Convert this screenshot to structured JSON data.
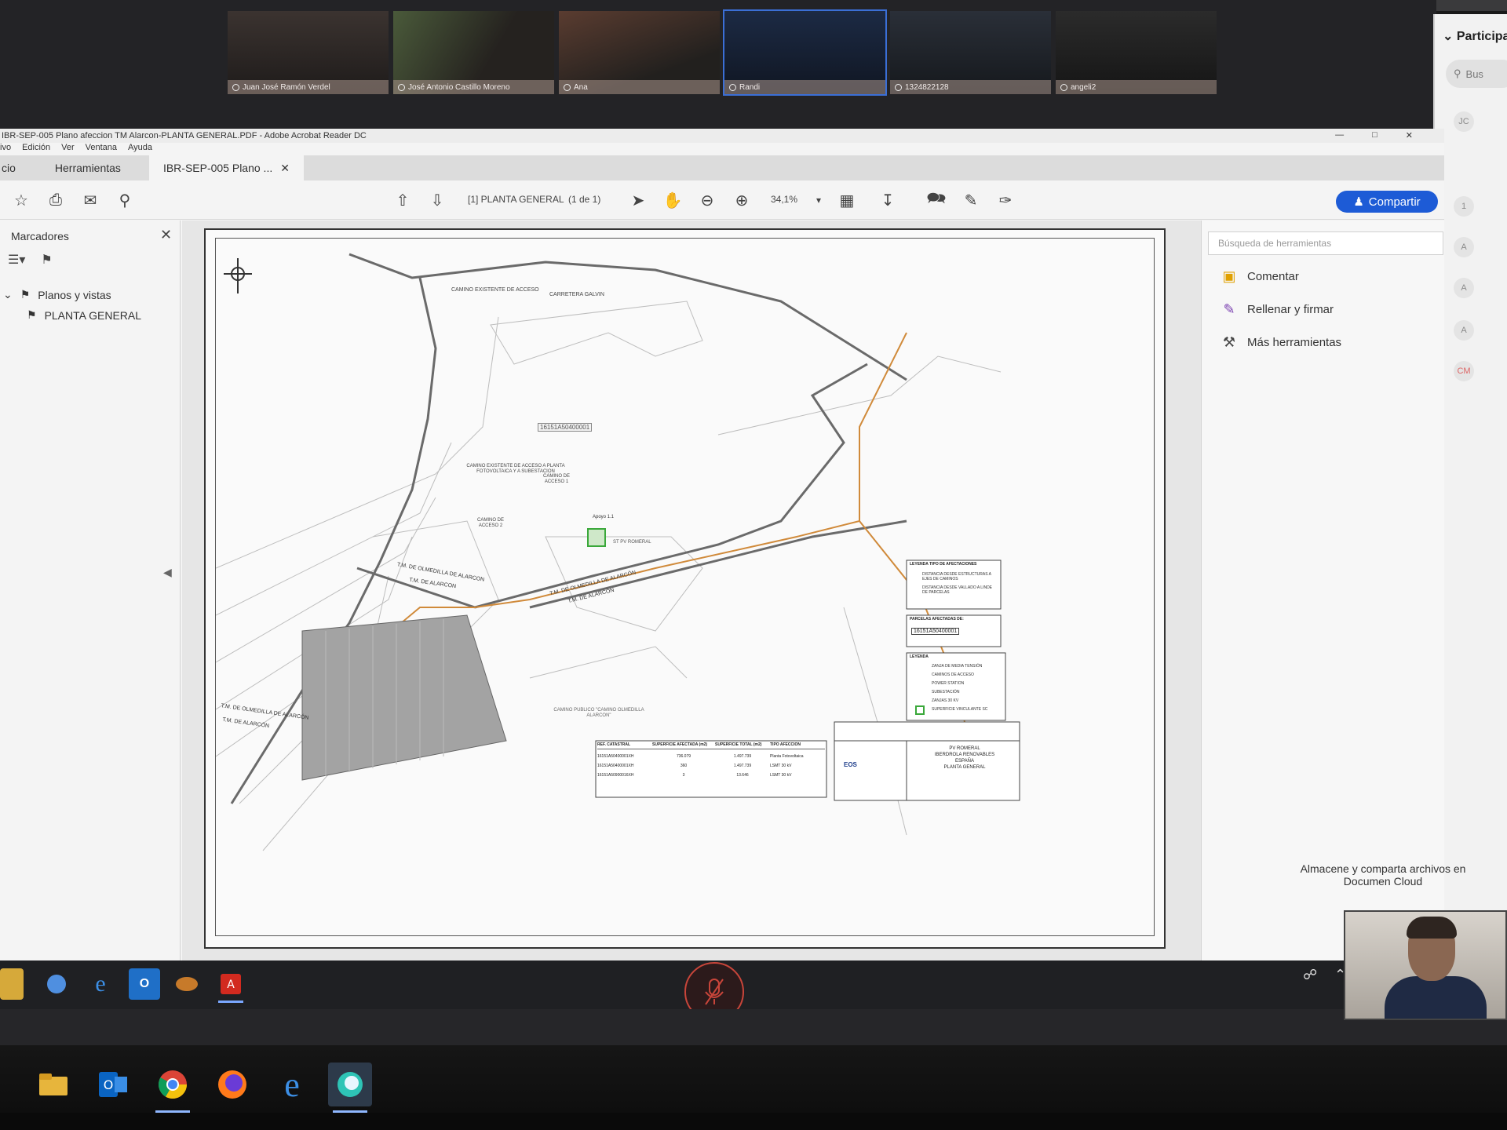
{
  "meeting": {
    "participants": [
      {
        "name": "Juan José Ramón Verdel"
      },
      {
        "name": "José Antonio Castillo Moreno"
      },
      {
        "name": "Ana"
      },
      {
        "name": "Randi"
      },
      {
        "name": "1324822128"
      },
      {
        "name": "angeli2"
      }
    ],
    "panel_title": "Participa",
    "search_placeholder": "Bus",
    "avatars": [
      "JC",
      "1",
      "A",
      "A",
      "A",
      "CM"
    ]
  },
  "acrobat": {
    "window_title": "IBR-SEP-005 Plano afeccion TM Alarcon-PLANTA GENERAL.PDF - Adobe Acrobat Reader DC",
    "menu": [
      "ivo",
      "Edición",
      "Ver",
      "Ventana",
      "Ayuda"
    ],
    "tabs": {
      "home": "cio",
      "tools": "Herramientas",
      "doc": "IBR-SEP-005 Plano ..."
    },
    "toolbar": {
      "page_label": "[1] PLANTA GENERAL",
      "page_count": "(1 de 1)",
      "zoom": "34,1%",
      "share_label": "Compartir"
    },
    "bookmarks": {
      "header": "Marcadores",
      "items": [
        {
          "label": "Planos y vistas"
        },
        {
          "label": "PLANTA GENERAL"
        }
      ]
    },
    "tools_pane": {
      "search_placeholder": "Búsqueda de herramientas",
      "items": [
        {
          "label": "Comentar"
        },
        {
          "label": "Rellenar y firmar"
        },
        {
          "label": "Más herramientas"
        }
      ],
      "promo": "Almacene y comparta archivos en Documen Cloud"
    }
  },
  "plan": {
    "parcel_ref": "16151A50400001",
    "labels": {
      "camino_existente": "CAMINO EXISTENTE DE ACCESO",
      "carretera": "CARRETERA GALVIN",
      "camino_acceso_planta": "CAMINO EXISTENTE DE ACCESO A PLANTA FOTOVOLTAICA Y A SUBESTACION",
      "camino_acceso_1": "CAMINO DE ACCESO 1",
      "camino_acceso_2": "CAMINO DE ACCESO 2",
      "tm_olmedilla_1": "T.M. DE OLMEDILLA DE ALARCON",
      "tm_alarcon_1": "T.M. DE ALARCON",
      "tm_olmedilla_2": "T.M. DE OLMEDILLA DE ALARCÓN",
      "tm_alarcon_2": "T.M. DE ALARCÓN",
      "tm_olmedilla_3": "T.M. DE OLMEDILLA DE ALARCÓN",
      "tm_alarcon_3": "T.M. DE ALARCÓN",
      "apoyo": "Apoyo 1.1",
      "camino_publico": "CAMINO PUBLICO \"CAMINO OLMEDILLA ALARCON\"",
      "st": "ST PV ROMERAL"
    },
    "legend_titles": {
      "distancias": "LEYENDA TIPO DE AFECTACIONES",
      "parcelas": "PARCELAS AFECTADAS DE:",
      "leyenda": "LEYENDA"
    },
    "legend_rows": [
      "ZANJA DE MEDIA TENSIÓN",
      "CAMINOS DE ACCESO",
      "POWER STATION",
      "SUBESTACIÓN",
      "ZANJAS 30 KV",
      "SUPERFICIE VINCULANTE SC"
    ],
    "distance_rows": [
      "DISTANCIA DESDE ESTRUCTURAS A EJES DE CAMINOS",
      "DISTANCIA DESDE VALLADO A LINDE DE PARCELAS"
    ],
    "table": {
      "headers": [
        "REF. CATASTRAL",
        "SUPERFICIE AFECTADA (m2)",
        "SUPERFICIE TOTAL (m2)",
        "TIPO AFECCION"
      ],
      "rows": [
        [
          "16151A50400001XH",
          "736.079",
          "1.497.739",
          "Planta Fotovoltaica"
        ],
        [
          "16151A50400001XH",
          "360",
          "1.497.739",
          "LSMT 30 kV"
        ],
        [
          "16151A50900016XH",
          "3",
          "13.646",
          "LSMT 30 kV"
        ]
      ]
    },
    "title_block": [
      "PV ROMERAL",
      "IBERDROLA RENOVABLES",
      "ESPAÑA",
      "PLANTA GENERAL"
    ],
    "company": "EOS"
  }
}
